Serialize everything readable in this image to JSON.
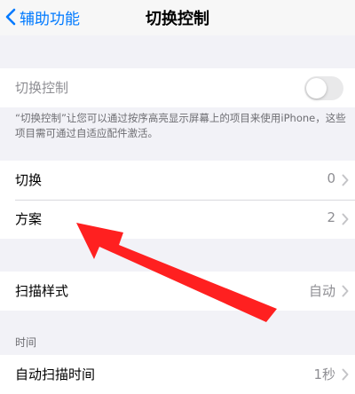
{
  "nav": {
    "back_label": "辅助功能",
    "title": "切换控制"
  },
  "switch_control": {
    "label": "切换控制",
    "enabled": false,
    "footer": "“切换控制”让您可以通过按序高亮显示屏幕上的项目来使用iPhone，这些项目需可通过自适应配件激活。"
  },
  "group1": [
    {
      "label": "切换",
      "value": "0"
    },
    {
      "label": "方案",
      "value": "2"
    }
  ],
  "scan_style": {
    "label": "扫描样式",
    "value": "自动"
  },
  "timing": {
    "header": "时间",
    "auto_scan": {
      "label": "自动扫描时间",
      "value": "1秒"
    }
  },
  "annotation": {
    "color": "#ff2020"
  }
}
